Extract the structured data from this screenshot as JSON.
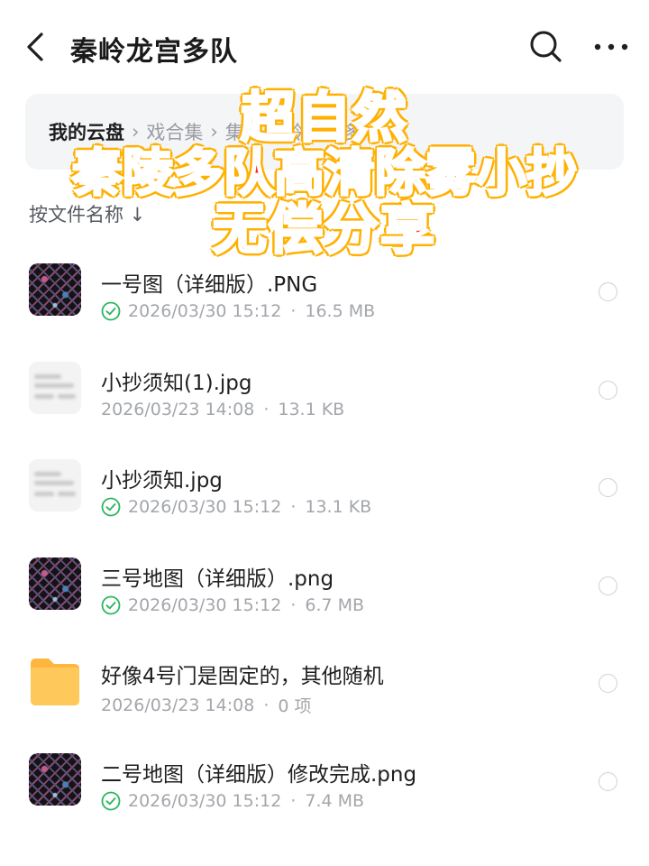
{
  "header": {
    "title": "秦岭龙宫多队",
    "back_icon": "chevron-left-icon",
    "search_icon": "search-icon",
    "more_icon": "more-horizontal-icon"
  },
  "breadcrumb": {
    "items": [
      "我的云盘",
      "戏合集",
      "集",
      "秦岭龙宫多队"
    ],
    "separator": "›"
  },
  "sort": {
    "label": "按文件名称 ↓"
  },
  "files": [
    {
      "name": "一号图（详细版）.PNG",
      "date": "2026/03/30 15:12",
      "size": "16.5 MB",
      "synced": true,
      "thumb": "map-image"
    },
    {
      "name": "小抄须知(1).jpg",
      "date": "2026/03/23 14:08",
      "size": "13.1 KB",
      "synced": false,
      "thumb": "document-image"
    },
    {
      "name": "小抄须知.jpg",
      "date": "2026/03/30 15:12",
      "size": "13.1 KB",
      "synced": true,
      "thumb": "document-image"
    },
    {
      "name": "三号地图（详细版）.png",
      "date": "2026/03/30 15:12",
      "size": "6.7 MB",
      "synced": true,
      "thumb": "map-image"
    },
    {
      "name": "好像4号门是固定的，其他随机",
      "date": "2026/03/23 14:08",
      "size": "0 项",
      "synced": false,
      "thumb": "folder-icon"
    },
    {
      "name": "二号地图（详细版）修改完成.png",
      "date": "2026/03/30 15:12",
      "size": "7.4 MB",
      "synced": true,
      "thumb": "map-image"
    }
  ],
  "meta_separator": "·",
  "overlay": {
    "line1": "超自然",
    "line2": "秦陵多队高清除雾小抄",
    "line3": "无偿分享"
  },
  "colors": {
    "synced_green": "#2db560",
    "folder_yellow": "#ffc14d",
    "overlay_red": "#ff2a1a",
    "overlay_stroke": "#ffb000"
  }
}
